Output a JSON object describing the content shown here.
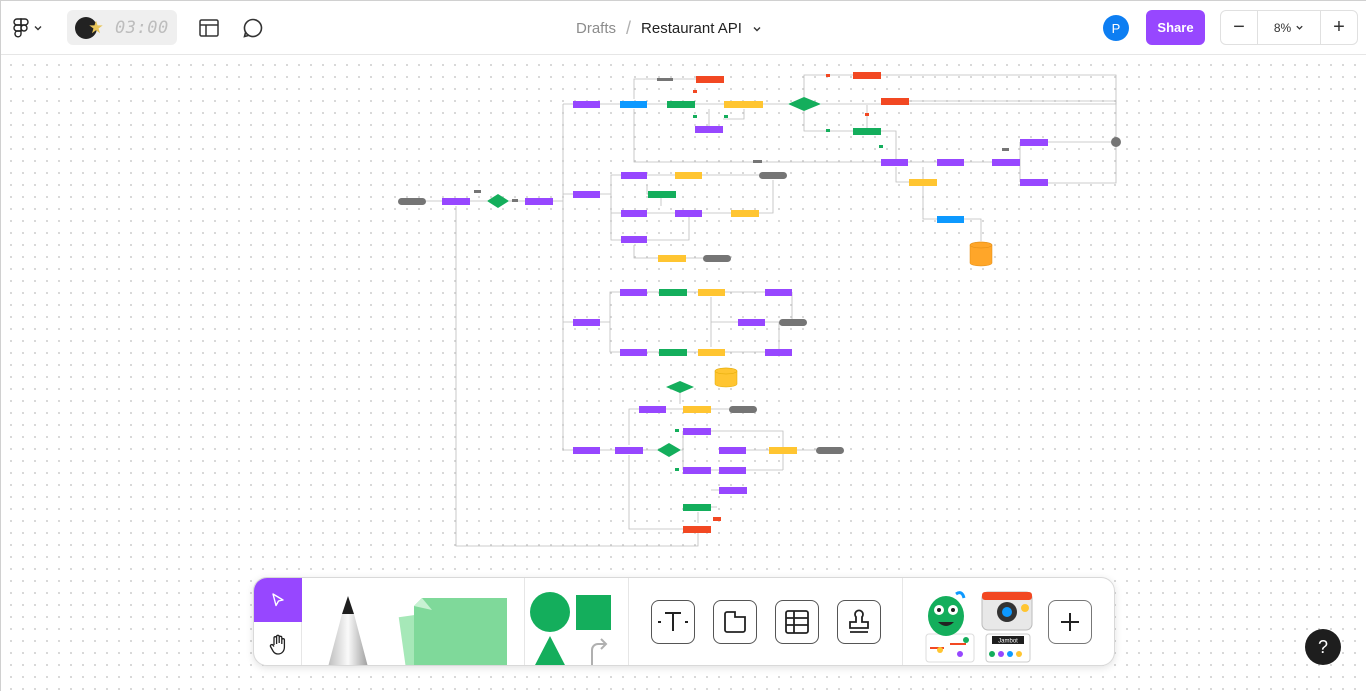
{
  "header": {
    "timer": "03:00",
    "breadcrumb_root": "Drafts",
    "breadcrumb_sep": "/",
    "file_title": "Restaurant API",
    "avatar_initial": "P",
    "share_label": "Share",
    "zoom_level": "8%",
    "zoom_out_label": "−",
    "zoom_in_label": "+"
  },
  "toolbar": {
    "tools": [
      "select",
      "hand",
      "marker",
      "sticky-note",
      "shapes",
      "connector",
      "text",
      "section",
      "table",
      "stamp",
      "widgets",
      "jambot",
      "more"
    ],
    "jambot_label": "Jambot"
  },
  "help": {
    "label": "?"
  },
  "colors": {
    "accent": "#9747ff",
    "avatar": "#0d7ef2",
    "node_purple": "#9747ff",
    "node_green": "#14ae5c",
    "node_yellow": "#ffc531",
    "node_red": "#f24822",
    "node_blue": "#0d99ff",
    "node_gray": "#757575",
    "db_orange": "#ffa629"
  }
}
